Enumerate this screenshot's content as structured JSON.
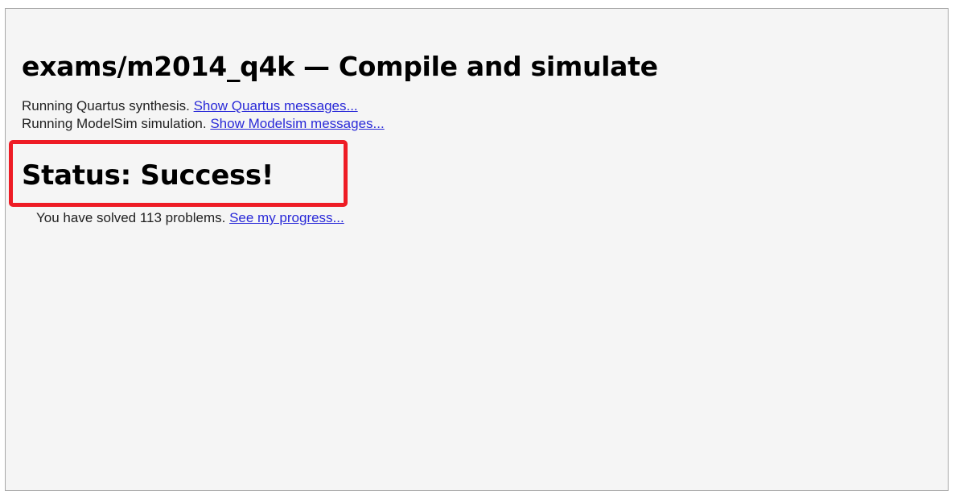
{
  "page": {
    "title": "exams/m2014_q4k — Compile and simulate"
  },
  "log": {
    "quartus_text": "Running Quartus synthesis. ",
    "quartus_link": "Show Quartus messages...",
    "modelsim_text": "Running ModelSim simulation. ",
    "modelsim_link": "Show Modelsim messages..."
  },
  "status": {
    "heading": "Status: Success!",
    "highlight_color": "#ee1c25"
  },
  "progress": {
    "text": "You have solved 113 problems. ",
    "link": "See my progress..."
  }
}
